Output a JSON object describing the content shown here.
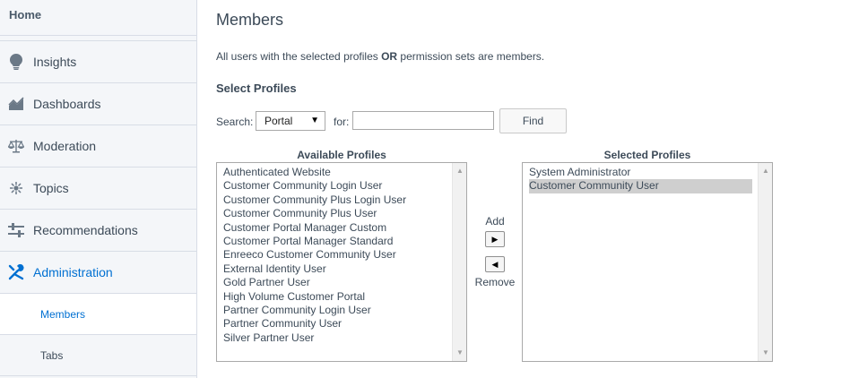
{
  "sidebar": {
    "home": "Home",
    "items": [
      {
        "label": "Insights",
        "icon": "lightbulb-icon"
      },
      {
        "label": "Dashboards",
        "icon": "chart-icon"
      },
      {
        "label": "Moderation",
        "icon": "scales-icon"
      },
      {
        "label": "Topics",
        "icon": "topics-icon"
      },
      {
        "label": "Recommendations",
        "icon": "sliders-icon"
      },
      {
        "label": "Administration",
        "icon": "tools-icon",
        "active": true
      }
    ],
    "sub_items": [
      {
        "label": "Members",
        "selected": true
      },
      {
        "label": "Tabs"
      }
    ]
  },
  "main": {
    "title": "Members",
    "description_pre": "All users with the selected profiles ",
    "description_bold": "OR",
    "description_post": " permission sets are members.",
    "section_title": "Select Profiles",
    "search": {
      "label": "Search:",
      "selected_option": "Portal",
      "for_label": "for:",
      "for_value": "",
      "find_label": "Find"
    },
    "available": {
      "header": "Available Profiles",
      "options": [
        "Authenticated Website",
        "Customer Community Login User",
        "Customer Community Plus Login User",
        "Customer Community Plus User",
        "Customer Portal Manager Custom",
        "Customer Portal Manager Standard",
        "Enreeco Customer Community User",
        "External Identity User",
        "Gold Partner User",
        "High Volume Customer Portal",
        "Partner Community Login User",
        "Partner Community User",
        "Silver Partner User"
      ]
    },
    "selected": {
      "header": "Selected Profiles",
      "options": [
        "System Administrator",
        "Customer Community User"
      ],
      "highlighted": "Customer Community User"
    },
    "add_label": "Add",
    "remove_label": "Remove"
  },
  "colors": {
    "accent": "#0070d2",
    "sidebar_bg": "#f4f6f9",
    "text": "#3c4a58"
  }
}
